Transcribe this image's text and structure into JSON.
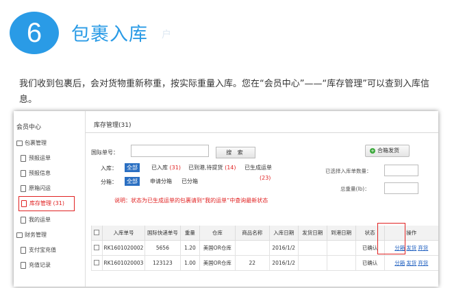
{
  "step": {
    "number": "6",
    "title": "包裹入库",
    "ghost": "户"
  },
  "intro": "我们收到包裹后，会对货物重新称重，按实际重量入库。您在“会员中心”——“库存管理”可以查到入库信息。",
  "colors": {
    "accent": "#2a9be6",
    "highlight": "#e02020",
    "link": "#2060c0"
  },
  "sidebar": {
    "title": "会员中心",
    "items": [
      {
        "label": "包裹管理",
        "icon": "box-icon",
        "section": true
      },
      {
        "label": "预报运单",
        "icon": "doc-icon"
      },
      {
        "label": "预报信息",
        "icon": "doc-icon"
      },
      {
        "label": "原箱闪运",
        "icon": "doc-icon"
      },
      {
        "label": "库存管理 (31)",
        "icon": "doc-icon",
        "active": true
      },
      {
        "label": "我的运单",
        "icon": "doc-icon"
      },
      {
        "label": "财务管理",
        "icon": "wallet-icon",
        "section": true
      },
      {
        "label": "支付宝充值",
        "icon": "doc-icon"
      },
      {
        "label": "充值记录",
        "icon": "doc-icon"
      }
    ]
  },
  "main": {
    "title": "库存管理(31)",
    "intl_label": "国际单号：",
    "intl_value": "",
    "search_label": "搜 索",
    "merge_label": "合箱发货",
    "stock_label": "入库：",
    "stock_filters": [
      {
        "label": "全部",
        "count": "",
        "on": true
      },
      {
        "label": "已入库 ",
        "count": "(31)"
      },
      {
        "label": "已到港,待提货 ",
        "count": "(14)"
      },
      {
        "label": "已生成运单",
        "count": "(23)"
      }
    ],
    "split_label": "分箱：",
    "split_filters": [
      {
        "label": "全部",
        "on": true
      },
      {
        "label": "申请分箱"
      },
      {
        "label": "已分箱"
      }
    ],
    "note": "说明：状态为已生成运单的包裹请到“我的运单”中查询最新状态",
    "selected_count_label": "已选择入库单数量：",
    "total_weight_label": "总重量(lb)："
  },
  "table": {
    "headers": [
      "",
      "入库单号",
      "国际快递单号",
      "重量",
      "仓库",
      "商品名称",
      "入库日期",
      "发货日期",
      "到港日期",
      "状态",
      "操作"
    ],
    "rows": [
      [
        "",
        "RK1601020002",
        "5656",
        "1.20",
        "美国OR仓库",
        "",
        "2016/1/2",
        "",
        "",
        "已确认",
        ""
      ],
      [
        "",
        "RK1601020003",
        "123123",
        "1.00",
        "美国OR仓库",
        "22",
        "2016/1/2",
        "",
        "",
        "已确认",
        ""
      ]
    ],
    "ops": [
      "分箱",
      "发货",
      "弃货"
    ]
  }
}
